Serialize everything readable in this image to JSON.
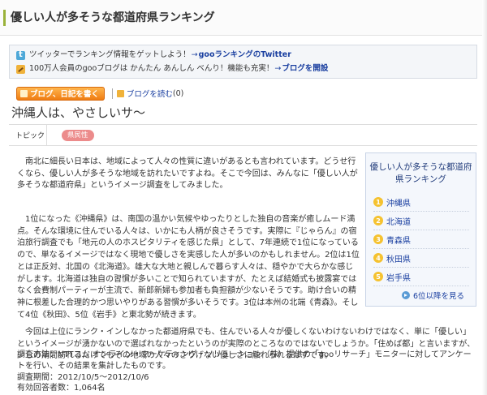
{
  "page": {
    "title": "優しい人が多そうな都道府県ランキング"
  },
  "info": {
    "twitter_text": "ツイッターでランキング情報をゲットしよう！",
    "twitter_arrow": "→",
    "twitter_link": "gooランキングのTwitter",
    "blog_text": "100万人会員のgooブログは かんたん あんしん べんり！機能も充実！",
    "blog_arrow": "→",
    "blog_link": "ブログを開設"
  },
  "actions": {
    "write_blog_label": "ブログ、日記を書く",
    "read_blog_label": "ブログを読む",
    "read_blog_count": "(0)"
  },
  "article": {
    "title": "沖縄人は、やさしいサ〜",
    "topic_label": "トピック",
    "topic_tag": "県民性",
    "paragraph1": "　南北に細長い日本は、地域によって人々の性質に違いがあるとも言われています。どうせ行くなら、優しい人が多そうな地域を訪れたいですよね。そこで今回は、みんなに「優しい人が多そうな都道府県」というイメージ調査をしてみました。",
    "paragraph2": "　1位になった《沖縄県》は、南国の温かい気候やゆったりとした独自の音楽が癒しムード満点。そんな環境に住んでいる人々は、いかにも人柄が良さそうです。実際に『じゃらん』の宿泊旅行調査でも「地元の人のホスピタリティを感じた県」として、7年連続で1位になっているので、単なるイメージではなく現地で優しさを実感した人が多いのかもしれません。2位は1位とは正反対、北国の《北海道》。雄大な大地と親しんで暮らす人々は、穏やかで大らかな感じがします。北海道は独自の習慣が多いことで知られていますが、たとえば結婚式も披露宴ではなく会費制パーティーが主流で、新郎新婦も参加者も負担額が少ないそうです。助け合いの精神に根差した合理的かつ思いやりがある習慣が多いそうです。3位は本州の北端《青森》。そして4位《秋田》、5位《岩手》と東北勢が続きます。",
    "paragraph3": "　今回は上位にランク・インしなかった都道府県でも、住んでいる人々が優しくないわけないわけではなく、単に「優しい」というイメージが湧かないので選ばれなかったというのが実際のところなのではないでしょうか。「住めば都」と言いますが、少しの期間訪れるだけでもその地域の人々のさりげない優しさに触れられるはずです。",
    "method_line1": "調査方法：NTTコム オンライン・マーケティング・ソリューション（株）提供の「gooリサーチ」モニターに対してアンケートを行い、その結果を集計したものです。",
    "method_line2": "調査期間：2012/10/5〜2012/10/6",
    "method_line3": "有効回答者数：1,064名"
  },
  "sidebar": {
    "title": "優しい人が多そうな都道府県ランキング",
    "items": [
      {
        "rank": "1",
        "name": "沖縄県"
      },
      {
        "rank": "2",
        "name": "北海道"
      },
      {
        "rank": "3",
        "name": "青森県"
      },
      {
        "rank": "4",
        "name": "秋田県"
      },
      {
        "rank": "5",
        "name": "岩手県"
      }
    ],
    "more_label": "6位以降を見る"
  },
  "colors": {
    "accent_green": "#9ab23a",
    "link_blue": "#1a3fa0",
    "button_orange": "#ef7d12",
    "tag_pink": "#ec8b8b",
    "rank_badge": "#f5c230"
  },
  "icons": [
    "twitter-icon",
    "pencil-icon",
    "more-arrow-icon"
  ]
}
